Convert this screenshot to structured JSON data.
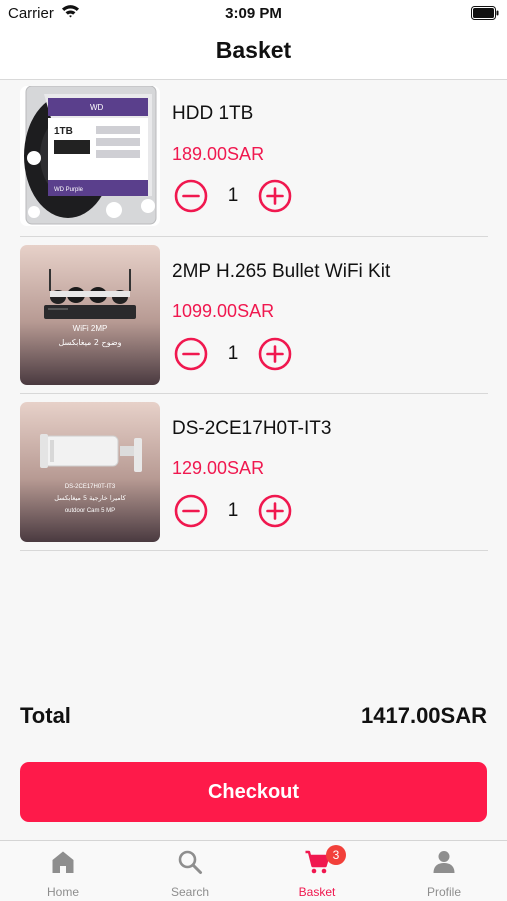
{
  "status_bar": {
    "carrier": "Carrier",
    "time": "3:09 PM"
  },
  "nav": {
    "title": "Basket"
  },
  "items": [
    {
      "name": "HDD 1TB",
      "price": "189.00SAR",
      "quantity": "1",
      "image_text": [
        "WD",
        "1TB",
        "WD Purple"
      ]
    },
    {
      "name": "2MP H.265 Bullet WiFi Kit",
      "price": "1099.00SAR",
      "quantity": "1",
      "image_text": [
        "WiFi 2MP",
        "وضوح 2 ميغابكسل"
      ]
    },
    {
      "name": "DS-2CE17H0T-IT3",
      "price": "129.00SAR",
      "quantity": "1",
      "image_text": [
        "DS-2CE17H0T-IT3",
        "كاميرا خارجية 5 ميغابكسل",
        "outdoor Cam 5 MP"
      ]
    }
  ],
  "summary": {
    "total_label": "Total",
    "total_value": "1417.00SAR"
  },
  "checkout": {
    "label": "Checkout"
  },
  "tabs": [
    {
      "label": "Home",
      "icon": "home-icon"
    },
    {
      "label": "Search",
      "icon": "search-icon"
    },
    {
      "label": "Basket",
      "icon": "cart-icon",
      "badge": "3",
      "active": true
    },
    {
      "label": "Profile",
      "icon": "person-icon"
    }
  ],
  "colors": {
    "accent": "#f0184f",
    "button": "#fe1a4a",
    "badge": "#f2403a",
    "tab_inactive": "#8e8e8e"
  }
}
